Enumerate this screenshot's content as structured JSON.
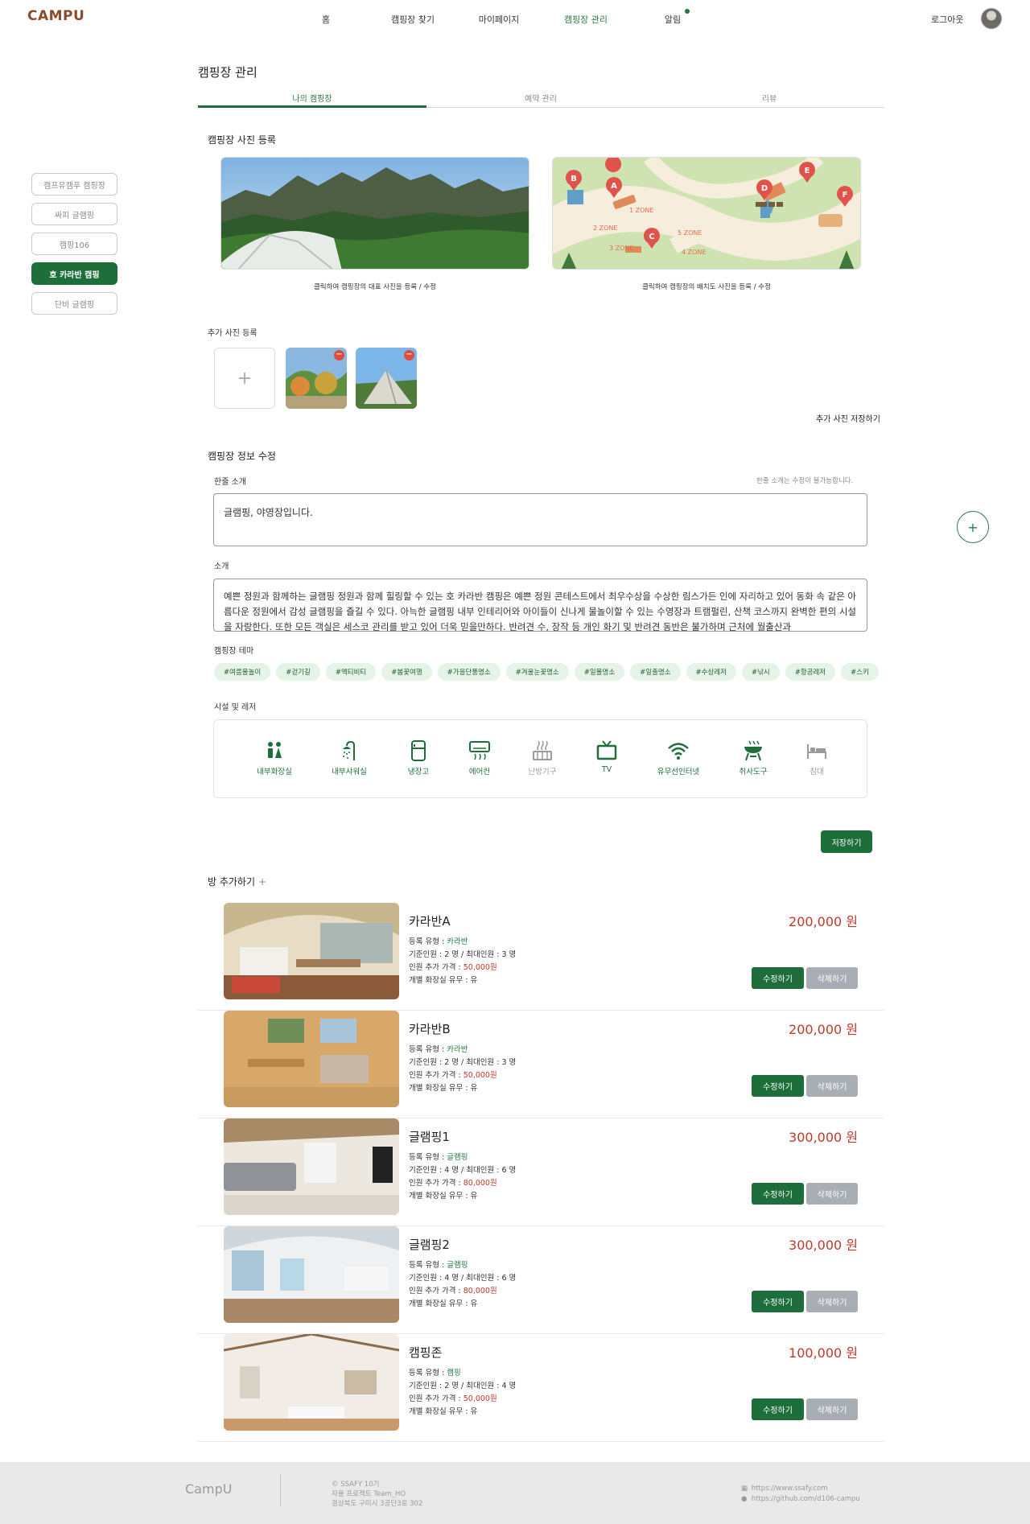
{
  "header": {
    "logo": "CAMPU",
    "nav": [
      "홈",
      "캠핑장 찾기",
      "마이페이지",
      "캠핑장 관리",
      "알림"
    ],
    "active_nav": "캠핑장 관리",
    "logout": "로그아웃"
  },
  "sidebar": {
    "items": [
      "캠프유캠푸 캠핑장",
      "싸피 글램핑",
      "캠핑106",
      "호 카라반 캠핑",
      "단비 글램핑"
    ],
    "active": "호 카라반 캠핑"
  },
  "page": {
    "title": "캠핑장 관리",
    "tabs": [
      "나의 캠핑장",
      "예약 관리",
      "리뷰"
    ]
  },
  "photos": {
    "title": "캠핑장 사진 등록",
    "main_caption": "클릭하여 캠핑장의 대표 사진을 등록 / 수정",
    "map_caption": "클릭하여 캠핑장의 배치도 사진을 등록 / 수정",
    "map_labels": [
      "1 ZONE",
      "2 ZONE",
      "3 ZONE",
      "4 ZONE",
      "5 ZONE"
    ],
    "map_pins": [
      "A",
      "B",
      "C",
      "D",
      "E",
      "F"
    ],
    "extra_title": "추가 사진 등록",
    "add_symbol": "+",
    "remove_symbol": "−",
    "save_extra": "추가 사진 저장하기"
  },
  "info": {
    "title": "캠핑장 정보 수정",
    "oneline_label": "한줄 소개",
    "oneline_note": "한줄 소개는 수정이 불가능합니다.",
    "oneline_value": "글램핑, 야영장입니다.",
    "desc_label": "소개",
    "desc_value": "예쁜 정원과 함께하는 글램핑 정원과 함께 힐링할 수 있는 호 카라반 캠핑은 예쁜 정원 콘테스트에서 최우수상을 수상한 림스가든 인에 자리하고 있어 동화 속 같은 아름다운 정원에서 감성 글램핑을 즐길 수 있다. 아늑한 글램핑 내부 인테리어와 아이들이 신나게 물놀이할 수 있는 수영장과 트램펄린, 산책 코스까지 완벽한 편의 시설을 자랑한다. 또한 모든 객실은 세스코 관리를 받고 있어 더욱 믿을만하다. 반려견 수, 장작 등 개인 화기 및 반려견 동반은 불가하며 근처에 월출산과",
    "theme_label": "캠핑장 테마",
    "themes": [
      "#여름물놀이",
      "#걷기길",
      "#액티비티",
      "#봄꽃여행",
      "#가을단풍명소",
      "#겨울눈꽃명소",
      "#일몰명소",
      "#일출명소",
      "#수상레저",
      "#낚시",
      "#항공레저",
      "#스키"
    ],
    "facility_label": "시설 및 레저",
    "facilities": [
      {
        "label": "내부화장실",
        "icon": "restroom-icon",
        "on": true
      },
      {
        "label": "내부샤워실",
        "icon": "shower-icon",
        "on": true
      },
      {
        "label": "냉장고",
        "icon": "fridge-icon",
        "on": true
      },
      {
        "label": "에어컨",
        "icon": "aircon-icon",
        "on": true
      },
      {
        "label": "난방기구",
        "icon": "heater-icon",
        "on": false
      },
      {
        "label": "TV",
        "icon": "tv-icon",
        "on": true
      },
      {
        "label": "유무선인터넷",
        "icon": "wifi-icon",
        "on": true
      },
      {
        "label": "취사도구",
        "icon": "grill-icon",
        "on": true
      },
      {
        "label": "침대",
        "icon": "bed-icon",
        "on": false
      }
    ],
    "save": "저장하기"
  },
  "rooms": {
    "add_label": "방 추가하기",
    "add_symbol": "+",
    "labels": {
      "type": "등록 유형 : ",
      "base": "기준인원 : ",
      "max": " / 최대인원 : ",
      "person": " 명",
      "extra": "인원 추가 가격 : ",
      "toilet": "개별 화장실 유무 : ",
      "edit": "수정하기",
      "delete": "삭제하기"
    },
    "items": [
      {
        "name": "카라반A",
        "type": "카라반",
        "base": "2",
        "max": "3",
        "extra_price": "50,000원",
        "toilet": "유",
        "price": "200,000 원"
      },
      {
        "name": "카라반B",
        "type": "카라반",
        "base": "2",
        "max": "3",
        "extra_price": "50,000원",
        "toilet": "유",
        "price": "200,000 원"
      },
      {
        "name": "글램핑1",
        "type": "글램핑",
        "base": "4",
        "max": "6",
        "extra_price": "80,000원",
        "toilet": "유",
        "price": "300,000 원"
      },
      {
        "name": "글램핑2",
        "type": "글램핑",
        "base": "4",
        "max": "6",
        "extra_price": "80,000원",
        "toilet": "유",
        "price": "300,000 원"
      },
      {
        "name": "캠핑존",
        "type": "캠핑",
        "base": "2",
        "max": "4",
        "extra_price": "50,000원",
        "toilet": "유",
        "price": "100,000 원"
      }
    ]
  },
  "fab": "+",
  "footer": {
    "logo": "CampU",
    "info": [
      "© SSAFY 10기",
      "자율 프로젝트 Team_HO",
      "경상북도 구미시 3공단3로 302"
    ],
    "links": [
      "https://www.ssafy.com",
      "https://github.com/d106-campu"
    ]
  }
}
